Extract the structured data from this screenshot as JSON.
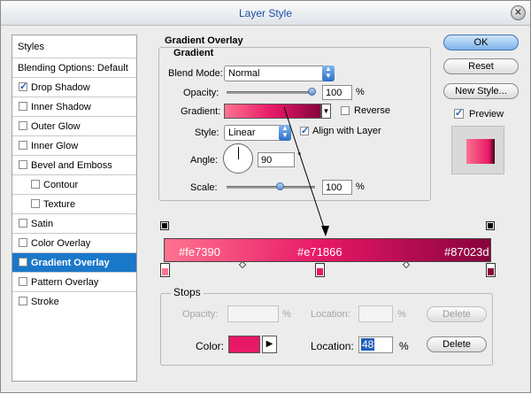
{
  "window": {
    "title": "Layer Style"
  },
  "styles_list": {
    "header": "Styles",
    "blending": "Blending Options: Default",
    "items": [
      {
        "label": "Drop Shadow",
        "checked": true
      },
      {
        "label": "Inner Shadow",
        "checked": false
      },
      {
        "label": "Outer Glow",
        "checked": false
      },
      {
        "label": "Inner Glow",
        "checked": false
      },
      {
        "label": "Bevel and Emboss",
        "checked": false
      },
      {
        "label": "Contour",
        "checked": false
      },
      {
        "label": "Texture",
        "checked": false
      },
      {
        "label": "Satin",
        "checked": false
      },
      {
        "label": "Color Overlay",
        "checked": false
      },
      {
        "label": "Gradient Overlay",
        "checked": true,
        "selected": true
      },
      {
        "label": "Pattern Overlay",
        "checked": false
      },
      {
        "label": "Stroke",
        "checked": false
      }
    ]
  },
  "gradient_overlay": {
    "title": "Gradient Overlay",
    "section": "Gradient",
    "blend_mode_label": "Blend Mode:",
    "blend_mode_value": "Normal",
    "opacity_label": "Opacity:",
    "opacity_value": "100",
    "opacity_unit": "%",
    "gradient_label": "Gradient:",
    "reverse_label": "Reverse",
    "reverse_checked": false,
    "style_label": "Style:",
    "style_value": "Linear",
    "align_label": "Align with Layer",
    "align_checked": true,
    "angle_label": "Angle:",
    "angle_value": "90",
    "angle_unit": "°",
    "scale_label": "Scale:",
    "scale_value": "100",
    "scale_unit": "%"
  },
  "gradient_editor": {
    "stop_colors": [
      "#fe7390",
      "#e71866",
      "#87023d"
    ],
    "stop_labels": [
      "#fe7390",
      "#e71866",
      "#87023d"
    ],
    "stops_title": "Stops",
    "opacity_label": "Opacity:",
    "opacity_unit": "%",
    "location_label": "Location:",
    "location_unit": "%",
    "delete_label": "Delete",
    "color_label": "Color:",
    "color_value": "#e71866",
    "location_value": "48",
    "location_label2": "Location:",
    "location_unit2": "%",
    "delete_label2": "Delete"
  },
  "buttons": {
    "ok": "OK",
    "reset": "Reset",
    "new_style": "New Style...",
    "preview": "Preview",
    "preview_checked": true
  },
  "colors": {
    "accent": "#1a78c9",
    "title": "#1a4fa6"
  }
}
